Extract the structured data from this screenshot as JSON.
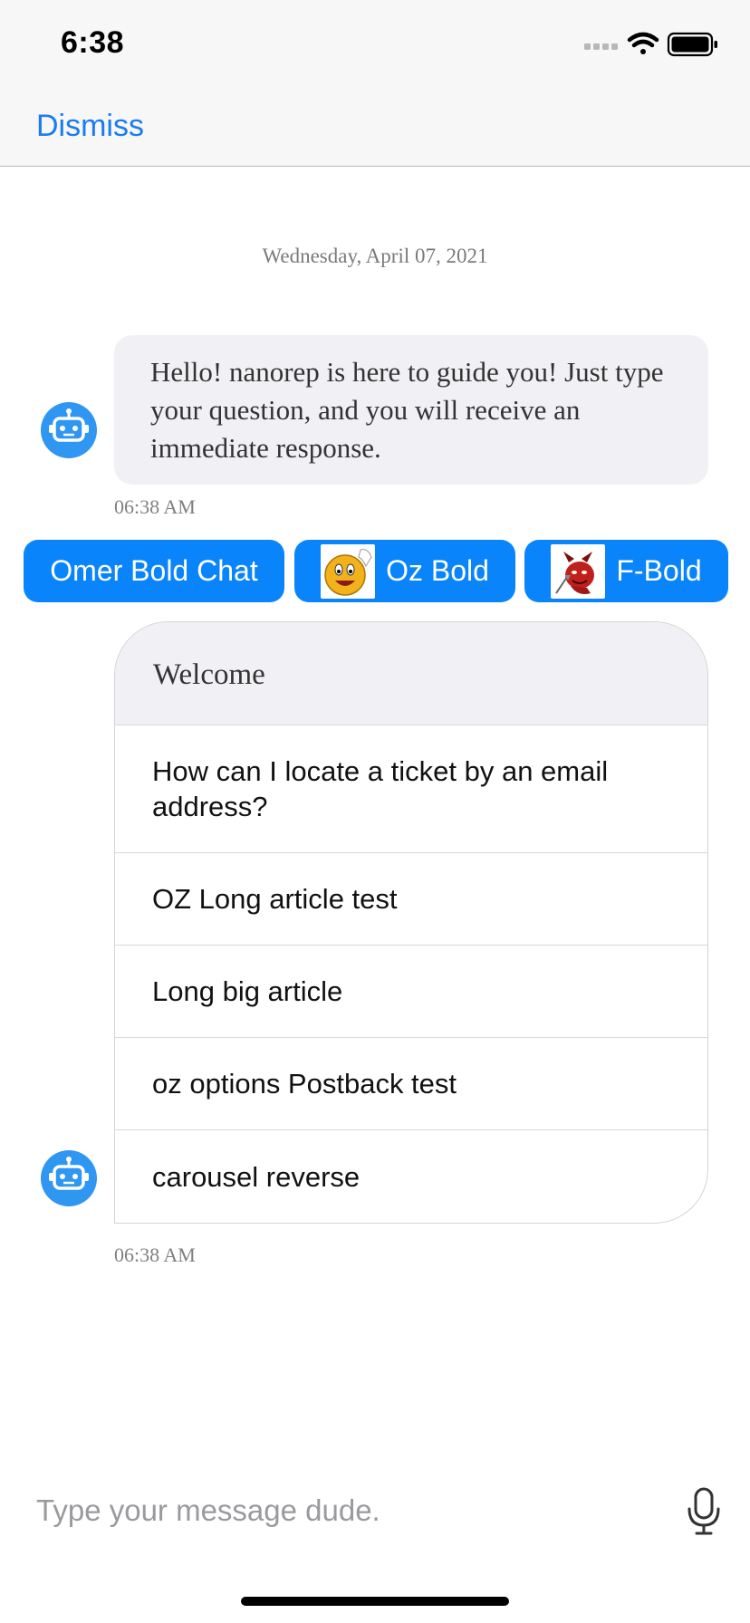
{
  "status_bar": {
    "time": "6:38"
  },
  "nav": {
    "dismiss_label": "Dismiss"
  },
  "chat": {
    "date_header": "Wednesday, April 07, 2021",
    "greeting": {
      "text": "Hello! nanorep is here to guide you! Just type your question, and you will receive an immediate response.",
      "timestamp": "06:38 AM"
    },
    "quick_replies": [
      {
        "label": "Omer Bold Chat",
        "icon": null
      },
      {
        "label": "Oz Bold",
        "icon": "smiley-waving-icon"
      },
      {
        "label": "F-Bold",
        "icon": "red-devil-icon"
      }
    ],
    "options_card": {
      "title": "Welcome",
      "options": [
        "How can I locate a ticket by an email address?",
        "OZ Long article test",
        "Long big article",
        "oz options Postback test",
        "carousel reverse"
      ],
      "timestamp": "06:38 AM"
    }
  },
  "composer": {
    "placeholder": "Type your message dude."
  },
  "colors": {
    "accent": "#0a84fa",
    "link": "#1a7cf4",
    "bubble": "#f1f1f5",
    "avatar": "#2f96f2"
  }
}
